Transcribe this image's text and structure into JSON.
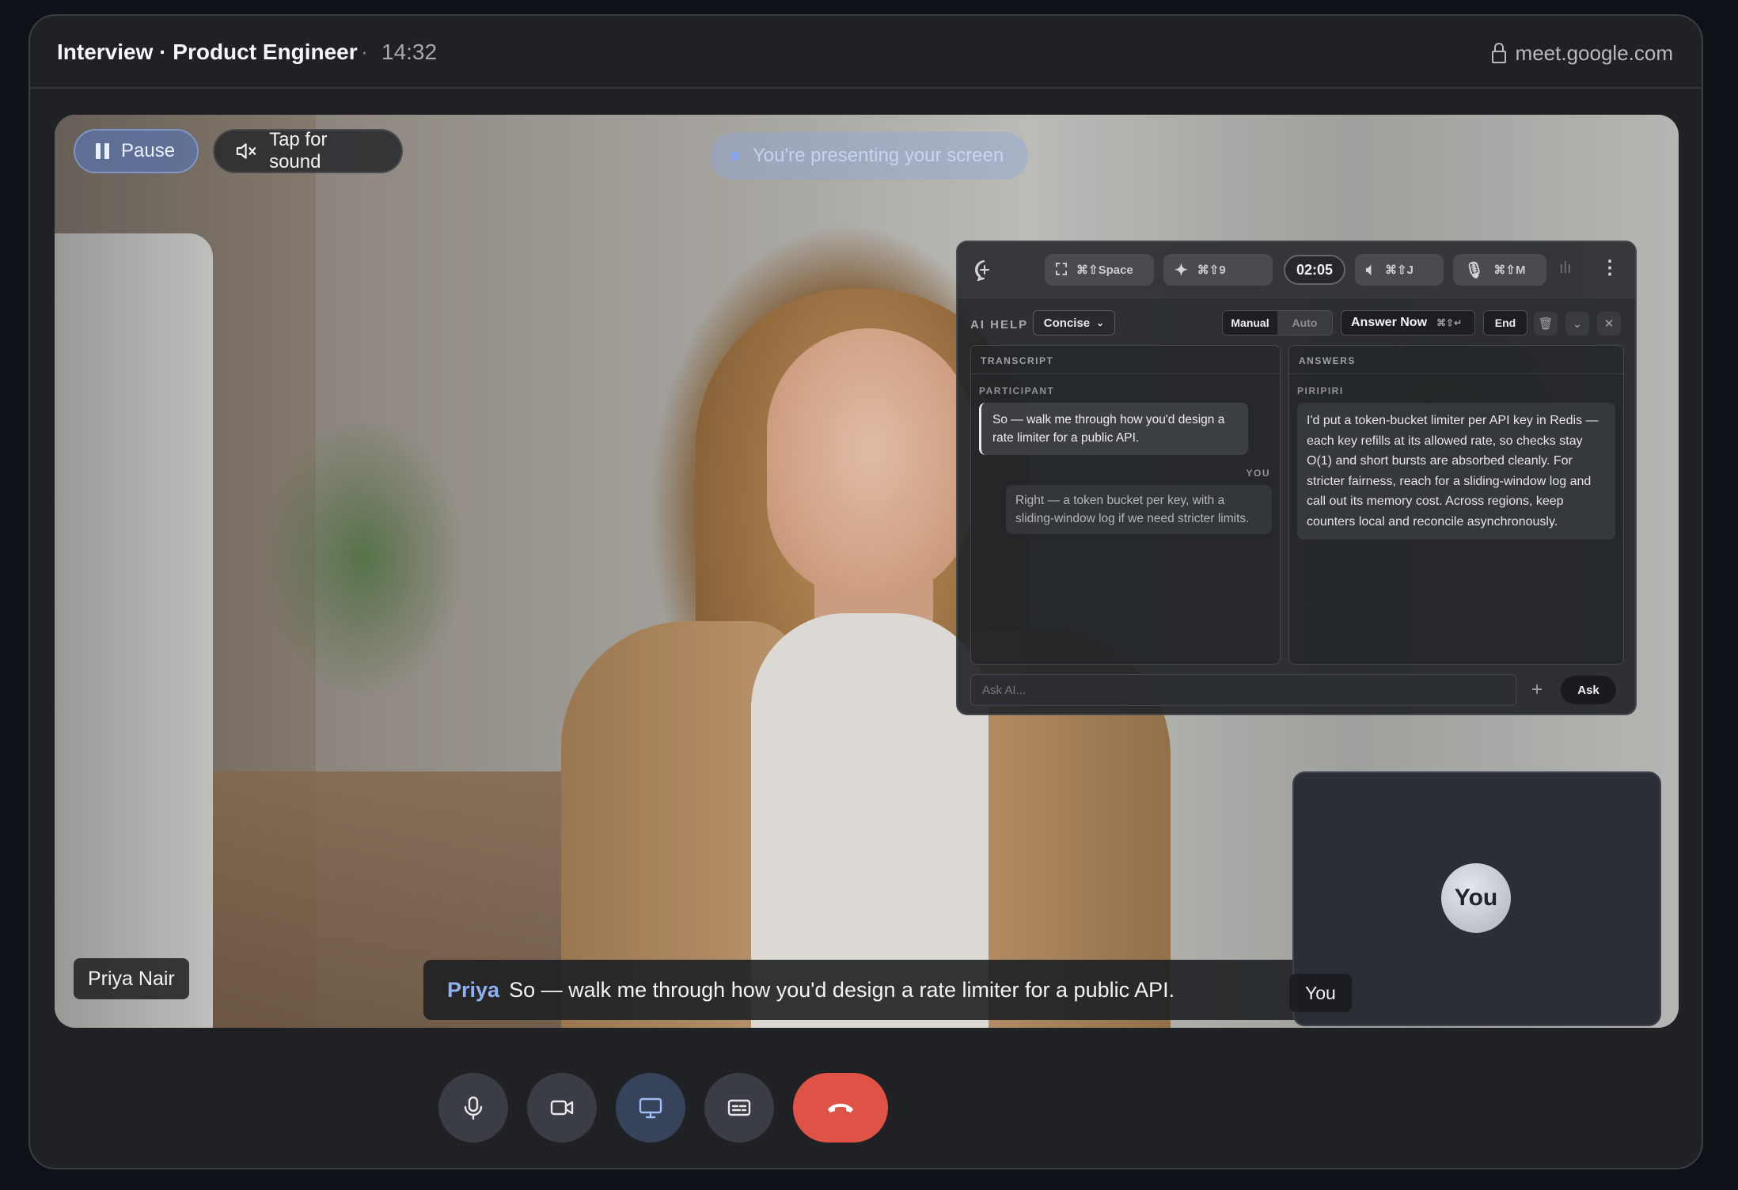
{
  "window": {
    "title": "Interview · Product Engineer",
    "separator": "·",
    "time": "14:32",
    "url": "meet.google.com"
  },
  "stage": {
    "pause_label": "Pause",
    "sound_label": "Tap for sound",
    "presenting_label": "You're presenting your screen",
    "participant_name": "Priya Nair",
    "caption_speaker": "Priya",
    "caption_text": "So — walk me through how you'd design a rate limiter for a public API."
  },
  "self_tile": {
    "avatar_text": "You",
    "label": "You"
  },
  "ai_panel": {
    "toolbar": {
      "capture_shortcut": "⌘⇧Space",
      "assist_shortcut": "⌘⇧9",
      "timer": "02:05",
      "audio_shortcut": "⌘⇧J",
      "mic_shortcut": "⌘⇧M"
    },
    "help_label": "AI HELP",
    "style_select": "Concise",
    "mode_manual": "Manual",
    "mode_auto": "Auto",
    "mode_selected": "Manual",
    "answer_now_label": "Answer Now",
    "answer_now_shortcut": "⌘⇧↵",
    "end_label": "End",
    "transcript": {
      "header": "TRANSCRIPT",
      "participant_label": "PARTICIPANT",
      "participant_message": "So — walk me through how you'd design a rate limiter for a public API.",
      "you_label": "YOU",
      "you_message": "Right — a token bucket per key, with a sliding-window log if we need stricter limits."
    },
    "answers": {
      "header": "ANSWERS",
      "source_label": "PIRIPIRI",
      "answer_text": "I'd put a token-bucket limiter per API key in Redis — each key refills at its allowed rate, so checks stay O(1) and short bursts are absorbed cleanly. For stricter fairness, reach for a sliding-window log and call out its memory cost. Across regions, keep counters local and reconcile asynchronously."
    },
    "ask_placeholder": "Ask AI...",
    "ask_button": "Ask"
  },
  "colors": {
    "window_bg": "#1f2125",
    "caption_speaker": "#8fb1f2",
    "end_call": "#df5346",
    "share_active": "#36435b"
  },
  "controls": {
    "icons": [
      "microphone-icon",
      "camera-icon",
      "screen-share-icon",
      "captions-icon",
      "end-call-icon"
    ]
  }
}
